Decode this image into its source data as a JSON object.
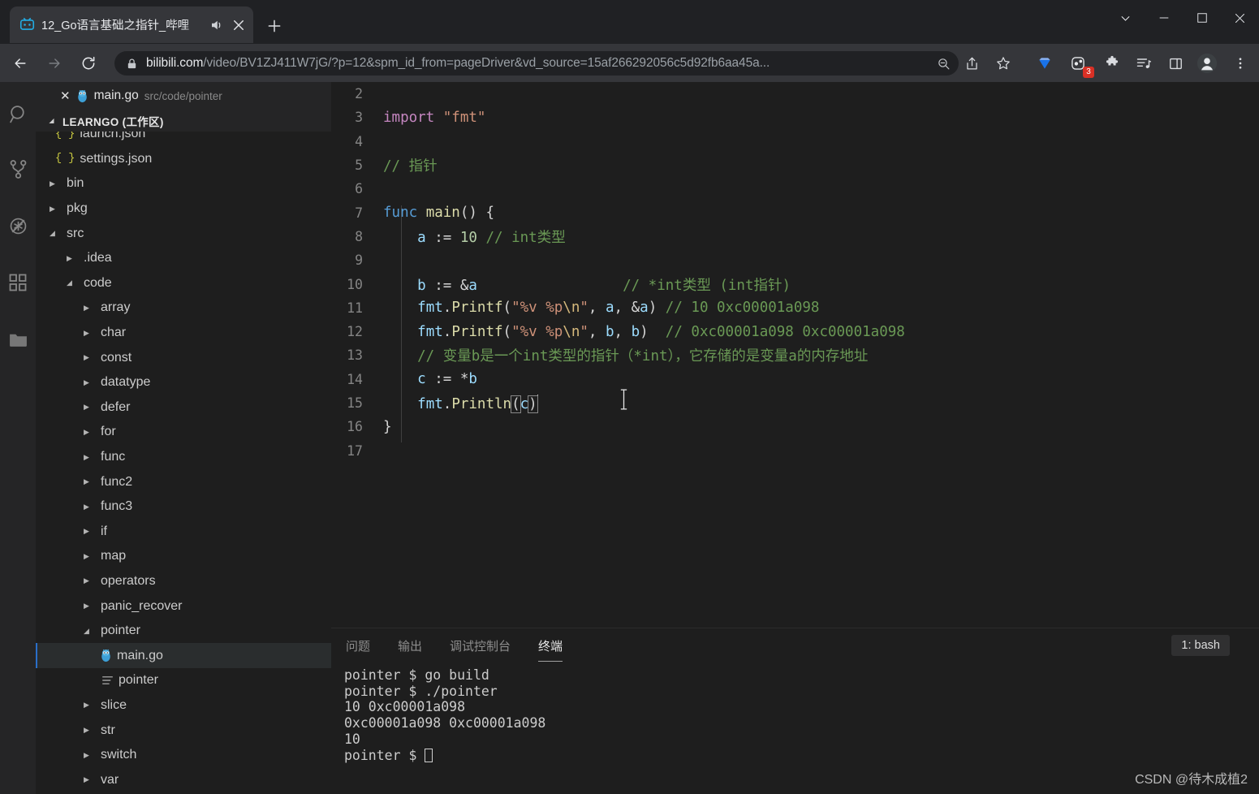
{
  "browser": {
    "tab": {
      "title": "12_Go语言基础之指针_哔哩",
      "favicon": "bilibili-tv-icon",
      "audio_icon": "speaker-playing-icon",
      "close_icon": "close-icon"
    },
    "new_tab_label": "+",
    "window_controls": {
      "tab_search": "chevron-down-icon",
      "minimize": "minimize-icon",
      "maximize": "maximize-icon",
      "close": "close-icon"
    },
    "nav": {
      "back": "arrow-back-icon",
      "forward": "arrow-forward-icon",
      "reload": "reload-icon"
    },
    "omnibox": {
      "lock_icon": "lock-icon",
      "url_domain": "bilibili.com",
      "url_rest": "/video/BV1ZJ411W7jG/?p=12&spm_id_from=pageDriver&vd_source=15af266292056c5d92fb6aa45a...",
      "zoom_icon": "zoom-out-icon"
    },
    "toolbar_icons": [
      {
        "name": "share-icon"
      },
      {
        "name": "bookmark-star-icon"
      },
      {
        "name": "diamond-extension-icon"
      },
      {
        "name": "extension-badge-icon",
        "badge": "3"
      },
      {
        "name": "puzzle-extensions-icon"
      },
      {
        "name": "media-playlist-icon"
      },
      {
        "name": "side-panel-icon"
      },
      {
        "name": "profile-avatar-icon"
      },
      {
        "name": "browser-menu-icon"
      }
    ]
  },
  "vscode": {
    "activitybar": [
      {
        "name": "search-icon"
      },
      {
        "name": "source-control-icon"
      },
      {
        "name": "run-debug-disabled-icon"
      },
      {
        "name": "extensions-icon"
      },
      {
        "name": "explorer-folder-icon"
      }
    ],
    "editor_tab": {
      "close_icon": "close-icon",
      "file_icon": "go-gopher-icon",
      "filename": "main.go",
      "filepath": "src/code/pointer"
    },
    "workspace": {
      "chevron": "chevron-open-icon",
      "title": "LEARNGO (工作区)"
    },
    "tree": [
      {
        "label": "launch.json",
        "type": "json",
        "indent": 1,
        "clipped": true
      },
      {
        "label": "settings.json",
        "type": "json",
        "indent": 1
      },
      {
        "label": "bin",
        "type": "folder",
        "indent": 1,
        "open": false
      },
      {
        "label": "pkg",
        "type": "folder",
        "indent": 1,
        "open": false
      },
      {
        "label": "src",
        "type": "folder",
        "indent": 1,
        "open": true
      },
      {
        "label": ".idea",
        "type": "folder",
        "indent": 2,
        "open": false
      },
      {
        "label": "code",
        "type": "folder",
        "indent": 2,
        "open": true
      },
      {
        "label": "array",
        "type": "folder",
        "indent": 3,
        "open": false
      },
      {
        "label": "char",
        "type": "folder",
        "indent": 3,
        "open": false
      },
      {
        "label": "const",
        "type": "folder",
        "indent": 3,
        "open": false
      },
      {
        "label": "datatype",
        "type": "folder",
        "indent": 3,
        "open": false
      },
      {
        "label": "defer",
        "type": "folder",
        "indent": 3,
        "open": false
      },
      {
        "label": "for",
        "type": "folder",
        "indent": 3,
        "open": false
      },
      {
        "label": "func",
        "type": "folder",
        "indent": 3,
        "open": false
      },
      {
        "label": "func2",
        "type": "folder",
        "indent": 3,
        "open": false
      },
      {
        "label": "func3",
        "type": "folder",
        "indent": 3,
        "open": false
      },
      {
        "label": "if",
        "type": "folder",
        "indent": 3,
        "open": false
      },
      {
        "label": "map",
        "type": "folder",
        "indent": 3,
        "open": false
      },
      {
        "label": "operators",
        "type": "folder",
        "indent": 3,
        "open": false
      },
      {
        "label": "panic_recover",
        "type": "folder",
        "indent": 3,
        "open": false
      },
      {
        "label": "pointer",
        "type": "folder",
        "indent": 3,
        "open": true
      },
      {
        "label": "main.go",
        "type": "go",
        "indent": 4,
        "selected": true
      },
      {
        "label": "pointer",
        "type": "binary",
        "indent": 4
      },
      {
        "label": "slice",
        "type": "folder",
        "indent": 3,
        "open": false
      },
      {
        "label": "str",
        "type": "folder",
        "indent": 3,
        "open": false
      },
      {
        "label": "switch",
        "type": "folder",
        "indent": 3,
        "open": false
      },
      {
        "label": "var",
        "type": "folder",
        "indent": 3,
        "open": false
      }
    ],
    "code_lines": [
      {
        "n": "2",
        "text": ""
      },
      {
        "n": "3",
        "text": "import \"fmt\""
      },
      {
        "n": "4",
        "text": ""
      },
      {
        "n": "5",
        "text": "// 指针"
      },
      {
        "n": "6",
        "text": ""
      },
      {
        "n": "7",
        "text": "func main() {"
      },
      {
        "n": "8",
        "text": "    a := 10 // int类型"
      },
      {
        "n": "9",
        "text": ""
      },
      {
        "n": "10",
        "text": "    b := &a                 // *int类型 (int指针)"
      },
      {
        "n": "11",
        "text": "    fmt.Printf(\"%v %p\\n\", a, &a) // 10 0xc00001a098"
      },
      {
        "n": "12",
        "text": "    fmt.Printf(\"%v %p\\n\", b, b)  // 0xc00001a098 0xc00001a098"
      },
      {
        "n": "13",
        "text": "    // 变量b是一个int类型的指针 (*int)，它存储的是变量a的内存地址"
      },
      {
        "n": "14",
        "text": "    c := *b"
      },
      {
        "n": "15",
        "text": "    fmt.Println(c)"
      },
      {
        "n": "16",
        "text": "}"
      },
      {
        "n": "17",
        "text": ""
      }
    ],
    "panel": {
      "tabs": [
        {
          "label": "问题",
          "active": false
        },
        {
          "label": "输出",
          "active": false
        },
        {
          "label": "调试控制台",
          "active": false
        },
        {
          "label": "终端",
          "active": true
        }
      ],
      "shell_selector": "1: bash",
      "terminal_lines": [
        "pointer $ go build",
        "pointer $ ./pointer",
        "10 0xc00001a098",
        "0xc00001a098 0xc00001a098",
        "10"
      ],
      "terminal_prompt": "pointer $ "
    }
  },
  "watermark": "CSDN @待木成植2",
  "colors": {
    "accent": "#2a6fc9",
    "badge_red": "#d93025",
    "go_blue": "#29beb0",
    "editor_bg": "#1e1e1e"
  }
}
